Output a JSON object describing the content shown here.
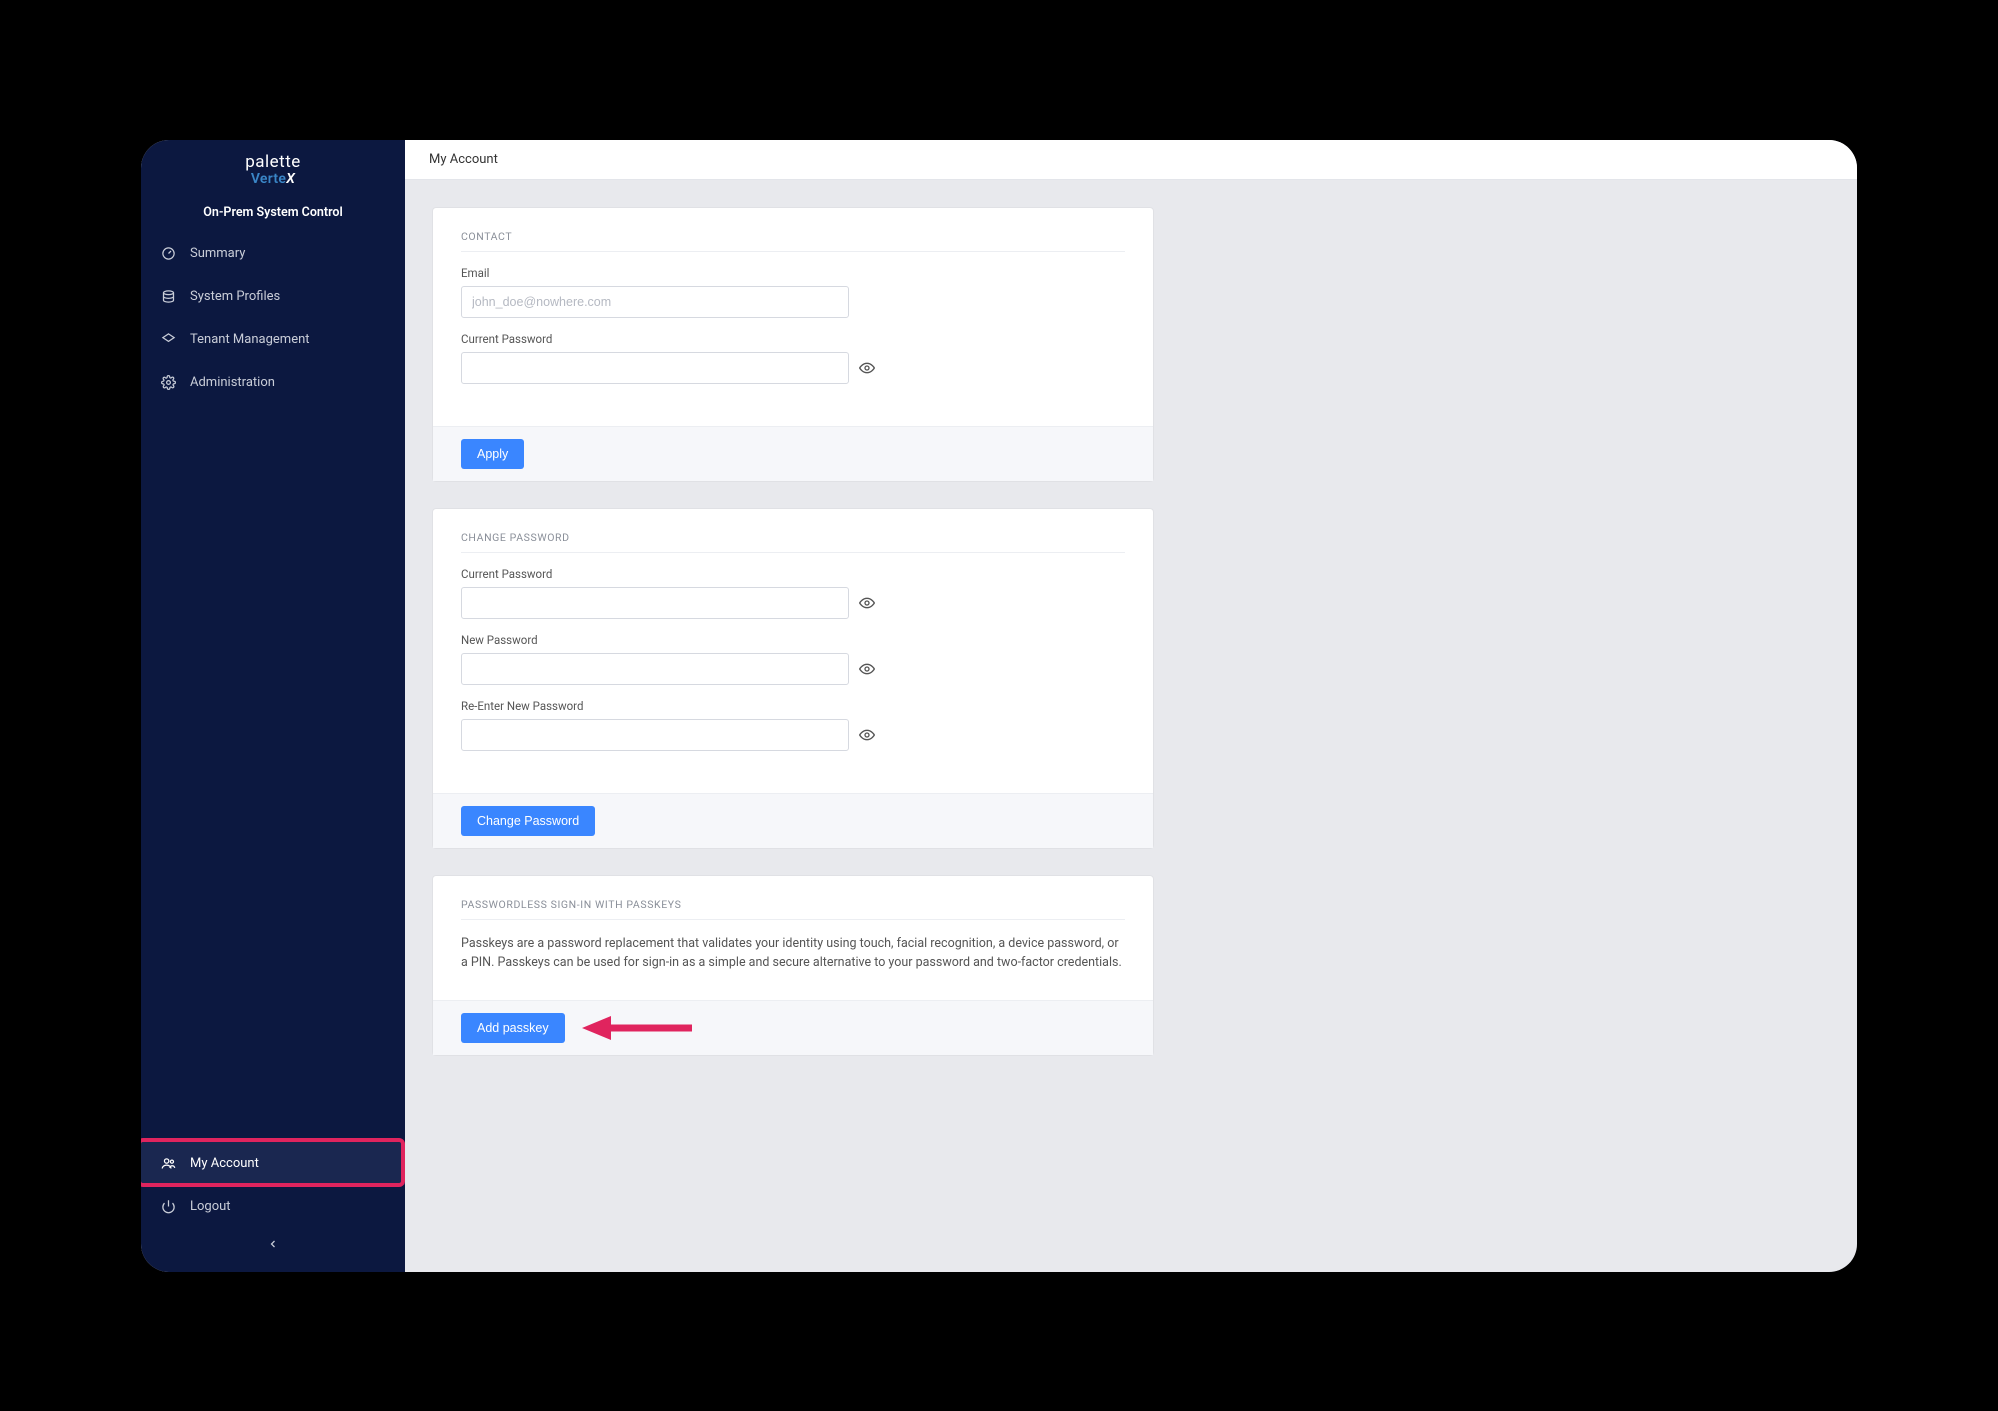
{
  "brand": {
    "line1": "palette",
    "line2_prefix": "Verte",
    "line2_suffix": "X",
    "subtitle": "On-Prem System Control"
  },
  "nav": {
    "summary": "Summary",
    "system_profiles": "System Profiles",
    "tenant_management": "Tenant Management",
    "administration": "Administration",
    "my_account": "My Account",
    "logout": "Logout"
  },
  "header": {
    "title": "My Account"
  },
  "contact": {
    "title": "CONTACT",
    "email_label": "Email",
    "email_placeholder": "john_doe@nowhere.com",
    "current_password_label": "Current Password",
    "apply": "Apply"
  },
  "change_password": {
    "title": "CHANGE PASSWORD",
    "current_label": "Current Password",
    "new_label": "New Password",
    "reenter_label": "Re-Enter New Password",
    "button": "Change Password"
  },
  "passkeys": {
    "title": "PASSWORDLESS SIGN-IN WITH PASSKEYS",
    "description": "Passkeys are a password replacement that validates your identity using touch, facial recognition, a device password, or a PIN. Passkeys can be used for sign-in as a simple and secure alternative to your password and two-factor credentials.",
    "button": "Add passkey"
  }
}
